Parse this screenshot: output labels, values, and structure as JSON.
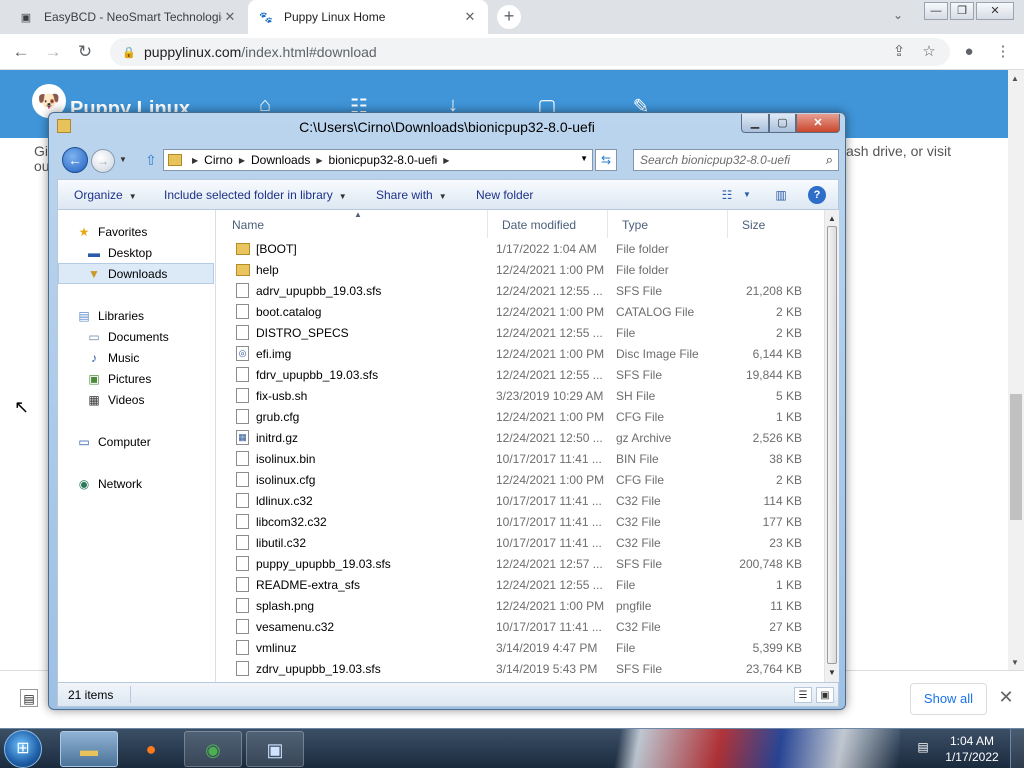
{
  "browser": {
    "tabs": [
      {
        "title": "EasyBCD - NeoSmart Technologie",
        "icon": "easybcd-icon"
      },
      {
        "title": "Puppy Linux Home",
        "icon": "puppy-icon"
      }
    ],
    "url_host": "puppylinux.com",
    "url_path": "/index.html#download"
  },
  "webpage": {
    "site_title": "Puppy Linux",
    "snippet_left": "Gi",
    "snippet_left2": "ou",
    "snippet_right": "ash drive, or visit"
  },
  "downloads_bar": {
    "show_all": "Show all"
  },
  "explorer": {
    "title": "C:\\Users\\Cirno\\Downloads\\bionicpup32-8.0-uefi",
    "breadcrumb": [
      "Cirno",
      "Downloads",
      "bionicpup32-8.0-uefi"
    ],
    "search_placeholder": "Search bionicpup32-8.0-uefi",
    "commands": {
      "organize": "Organize",
      "include": "Include selected folder in library",
      "share": "Share with",
      "new_folder": "New folder"
    },
    "nav": {
      "favorites": "Favorites",
      "desktop": "Desktop",
      "downloads": "Downloads",
      "libraries": "Libraries",
      "documents": "Documents",
      "music": "Music",
      "pictures": "Pictures",
      "videos": "Videos",
      "computer": "Computer",
      "network": "Network"
    },
    "columns": {
      "name": "Name",
      "date": "Date modified",
      "type": "Type",
      "size": "Size"
    },
    "files": [
      {
        "name": "[BOOT]",
        "date": "1/17/2022 1:04 AM",
        "type": "File folder",
        "size": ""
      },
      {
        "name": "help",
        "date": "12/24/2021 1:00 PM",
        "type": "File folder",
        "size": ""
      },
      {
        "name": "adrv_upupbb_19.03.sfs",
        "date": "12/24/2021 12:55 ...",
        "type": "SFS File",
        "size": "21,208 KB"
      },
      {
        "name": "boot.catalog",
        "date": "12/24/2021 1:00 PM",
        "type": "CATALOG File",
        "size": "2 KB"
      },
      {
        "name": "DISTRO_SPECS",
        "date": "12/24/2021 12:55 ...",
        "type": "File",
        "size": "2 KB"
      },
      {
        "name": "efi.img",
        "date": "12/24/2021 1:00 PM",
        "type": "Disc Image File",
        "size": "6,144 KB"
      },
      {
        "name": "fdrv_upupbb_19.03.sfs",
        "date": "12/24/2021 12:55 ...",
        "type": "SFS File",
        "size": "19,844 KB"
      },
      {
        "name": "fix-usb.sh",
        "date": "3/23/2019 10:29 AM",
        "type": "SH File",
        "size": "5 KB"
      },
      {
        "name": "grub.cfg",
        "date": "12/24/2021 1:00 PM",
        "type": "CFG File",
        "size": "1 KB"
      },
      {
        "name": "initrd.gz",
        "date": "12/24/2021 12:50 ...",
        "type": "gz Archive",
        "size": "2,526 KB"
      },
      {
        "name": "isolinux.bin",
        "date": "10/17/2017 11:41 ...",
        "type": "BIN File",
        "size": "38 KB"
      },
      {
        "name": "isolinux.cfg",
        "date": "12/24/2021 1:00 PM",
        "type": "CFG File",
        "size": "2 KB"
      },
      {
        "name": "ldlinux.c32",
        "date": "10/17/2017 11:41 ...",
        "type": "C32 File",
        "size": "114 KB"
      },
      {
        "name": "libcom32.c32",
        "date": "10/17/2017 11:41 ...",
        "type": "C32 File",
        "size": "177 KB"
      },
      {
        "name": "libutil.c32",
        "date": "10/17/2017 11:41 ...",
        "type": "C32 File",
        "size": "23 KB"
      },
      {
        "name": "puppy_upupbb_19.03.sfs",
        "date": "12/24/2021 12:57 ...",
        "type": "SFS File",
        "size": "200,748 KB"
      },
      {
        "name": "README-extra_sfs",
        "date": "12/24/2021 12:55 ...",
        "type": "File",
        "size": "1 KB"
      },
      {
        "name": "splash.png",
        "date": "12/24/2021 1:00 PM",
        "type": "pngfile",
        "size": "11 KB"
      },
      {
        "name": "vesamenu.c32",
        "date": "10/17/2017 11:41 ...",
        "type": "C32 File",
        "size": "27 KB"
      },
      {
        "name": "vmlinuz",
        "date": "3/14/2019 4:47 PM",
        "type": "File",
        "size": "5,399 KB"
      },
      {
        "name": "zdrv_upupbb_19.03.sfs",
        "date": "3/14/2019 5:43 PM",
        "type": "SFS File",
        "size": "23,764 KB"
      }
    ],
    "item_count": "21 items"
  },
  "taskbar": {
    "time": "1:04 AM",
    "date": "1/17/2022"
  },
  "colors": {
    "site_header": "#3f95d8",
    "chrome_tabstrip": "#dee1e6",
    "explorer_frame": "#9ec0e3"
  }
}
